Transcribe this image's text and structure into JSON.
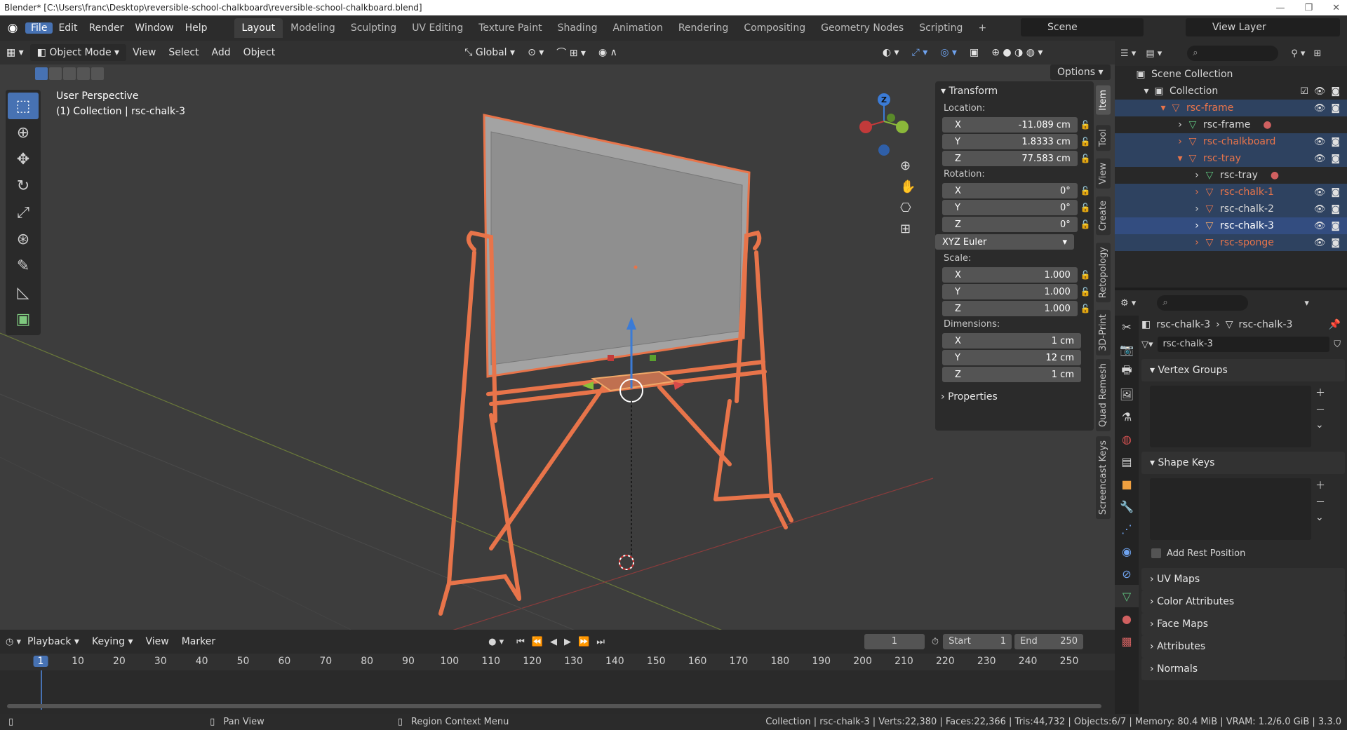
{
  "window": {
    "title": "Blender* [C:\\Users\\franc\\Desktop\\reversible-school-chalkboard\\reversible-school-chalkboard.blend]"
  },
  "menus": [
    "File",
    "Edit",
    "Render",
    "Window",
    "Help"
  ],
  "workspaces": [
    "Layout",
    "Modeling",
    "Sculpting",
    "UV Editing",
    "Texture Paint",
    "Shading",
    "Animation",
    "Rendering",
    "Compositing",
    "Geometry Nodes",
    "Scripting"
  ],
  "scene": {
    "name": "Scene",
    "view_layer": "View Layer"
  },
  "viewport": {
    "mode": "Object Mode",
    "menus": [
      "View",
      "Select",
      "Add",
      "Object"
    ],
    "transform_orientation": "Global",
    "options_label": "Options",
    "info_line1": "User Perspective",
    "info_line2": "(1) Collection | rsc-chalk-3",
    "gizmo_axis": "Z"
  },
  "npanel": {
    "transform_title": "Transform",
    "location_label": "Location:",
    "location": {
      "x": "-11.089 cm",
      "y": "1.8333 cm",
      "z": "77.583 cm"
    },
    "rotation_label": "Rotation:",
    "rotation": {
      "x": "0°",
      "y": "0°",
      "z": "0°"
    },
    "rotation_mode": "XYZ Euler",
    "scale_label": "Scale:",
    "scale": {
      "x": "1.000",
      "y": "1.000",
      "z": "1.000"
    },
    "dimensions_label": "Dimensions:",
    "dimensions": {
      "x": "1 cm",
      "y": "12 cm",
      "z": "1 cm"
    },
    "properties_title": "Properties",
    "axis_x": "X",
    "axis_y": "Y",
    "axis_z": "Z"
  },
  "npanel_tabs": [
    "Item",
    "Tool",
    "View",
    "Create",
    "Retopology",
    "3D-Print",
    "Quad Remesh",
    "Screencast Keys"
  ],
  "outliner": {
    "scene_collection": "Scene Collection",
    "items": [
      {
        "name": "Collection"
      },
      {
        "name": "rsc-frame"
      },
      {
        "name": "rsc-frame"
      },
      {
        "name": "rsc-chalkboard"
      },
      {
        "name": "rsc-tray"
      },
      {
        "name": "rsc-tray"
      },
      {
        "name": "rsc-chalk-1"
      },
      {
        "name": "rsc-chalk-2"
      },
      {
        "name": "rsc-chalk-3"
      },
      {
        "name": "rsc-sponge"
      }
    ]
  },
  "properties": {
    "breadcrumb_object": "rsc-chalk-3",
    "breadcrumb_mesh": "rsc-chalk-3",
    "mesh_name": "rsc-chalk-3",
    "sections": {
      "vertex_groups": "Vertex Groups",
      "shape_keys": "Shape Keys",
      "add_rest_position": "Add Rest Position",
      "uv_maps": "UV Maps",
      "color_attributes": "Color Attributes",
      "face_maps": "Face Maps",
      "attributes": "Attributes",
      "normals": "Normals"
    }
  },
  "timeline": {
    "menus": [
      "Playback",
      "Keying",
      "View",
      "Marker"
    ],
    "current_frame": "1",
    "start_label": "Start",
    "start": "1",
    "end_label": "End",
    "end": "250",
    "ruler": [
      "1",
      "10",
      "20",
      "30",
      "40",
      "50",
      "60",
      "70",
      "80",
      "90",
      "100",
      "110",
      "120",
      "130",
      "140",
      "150",
      "160",
      "170",
      "180",
      "190",
      "200",
      "210",
      "220",
      "230",
      "240",
      "250"
    ]
  },
  "statusbar": {
    "hint1": "Pan View",
    "hint2": "Region Context Menu",
    "stats": "Collection | rsc-chalk-3 | Verts:22,380 | Faces:22,366 | Tris:44,732 | Objects:6/7 | Memory: 80.4 MiB | VRAM: 1.2/6.0 GiB | 3.3.0"
  },
  "colors": {
    "accent": "#4772b3",
    "selected_orange": "#e8744a",
    "active_orange": "#f0a868",
    "viewport_bg": "#3d3d3d"
  }
}
